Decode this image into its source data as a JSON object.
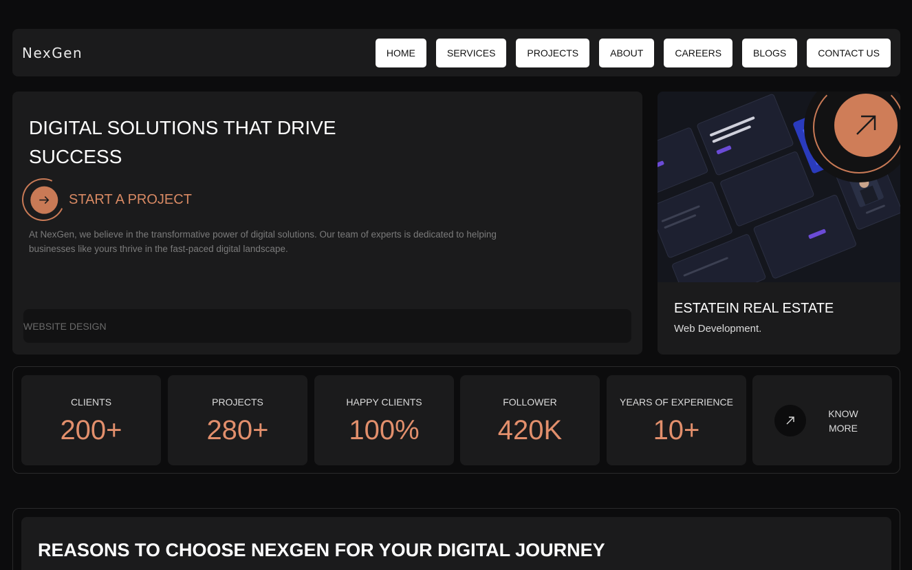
{
  "brand": {
    "name": "NexGen",
    "accent": "#cf7d58"
  },
  "nav": {
    "items": [
      {
        "label": "HOME"
      },
      {
        "label": "SERVICES"
      },
      {
        "label": "PROJECTS"
      },
      {
        "label": "ABOUT"
      },
      {
        "label": "CAREERS"
      },
      {
        "label": "BLOGS"
      },
      {
        "label": "CONTACT US"
      }
    ]
  },
  "hero": {
    "title": "DIGITAL SOLUTIONS THAT DRIVE SUCCESS",
    "cta_label": "START A PROJECT",
    "cta_icon": "arrow-right-icon",
    "description": "At NexGen, we believe in the transformative power of digital solutions. Our team of experts is dedicated to helping businesses like yours thrive in the fast-paced digital landscape.",
    "category": "WEBSITE DESIGN"
  },
  "project": {
    "title": "ESTATEIN REAL ESTATE",
    "subtitle": "Web Development.",
    "link_icon": "arrow-up-right-icon"
  },
  "stats": {
    "items": [
      {
        "label": "CLIENTS",
        "value": "200+"
      },
      {
        "label": "PROJECTS",
        "value": "280+"
      },
      {
        "label": "HAPPY CLIENTS",
        "value": "100%"
      },
      {
        "label": "FOLLOWER",
        "value": "420K"
      },
      {
        "label": "YEARS OF EXPERIENCE",
        "value": "10+"
      }
    ],
    "know_more": "KNOW MORE",
    "know_more_icon": "arrow-up-right-icon"
  },
  "reasons": {
    "title": "REASONS TO CHOOSE NEXGEN FOR YOUR DIGITAL JOURNEY"
  }
}
